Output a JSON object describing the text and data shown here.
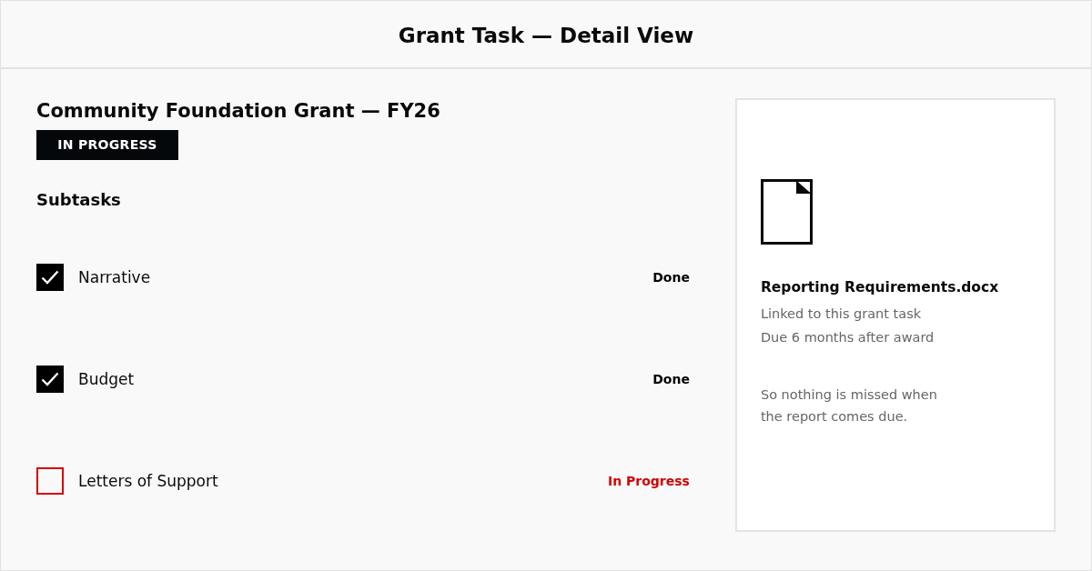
{
  "header": {
    "title": "Grant Task — Detail View"
  },
  "task": {
    "title": "Community Foundation Grant — FY26",
    "badge": "IN PROGRESS"
  },
  "subtasks_heading": "Subtasks",
  "subtasks": [
    {
      "label": "Narrative",
      "checked": true,
      "status": "Done",
      "color": "#000000"
    },
    {
      "label": "Budget",
      "checked": true,
      "status": "Done",
      "color": "#000000"
    },
    {
      "label": "Letters of Support",
      "checked": false,
      "status": "In Progress",
      "color": "#d40000"
    }
  ],
  "attachment": {
    "filename": "Reporting Requirements.docx",
    "details": [
      "Linked to this grant task",
      "Due 6 months after award"
    ],
    "note": "So nothing is missed when the report comes due."
  }
}
